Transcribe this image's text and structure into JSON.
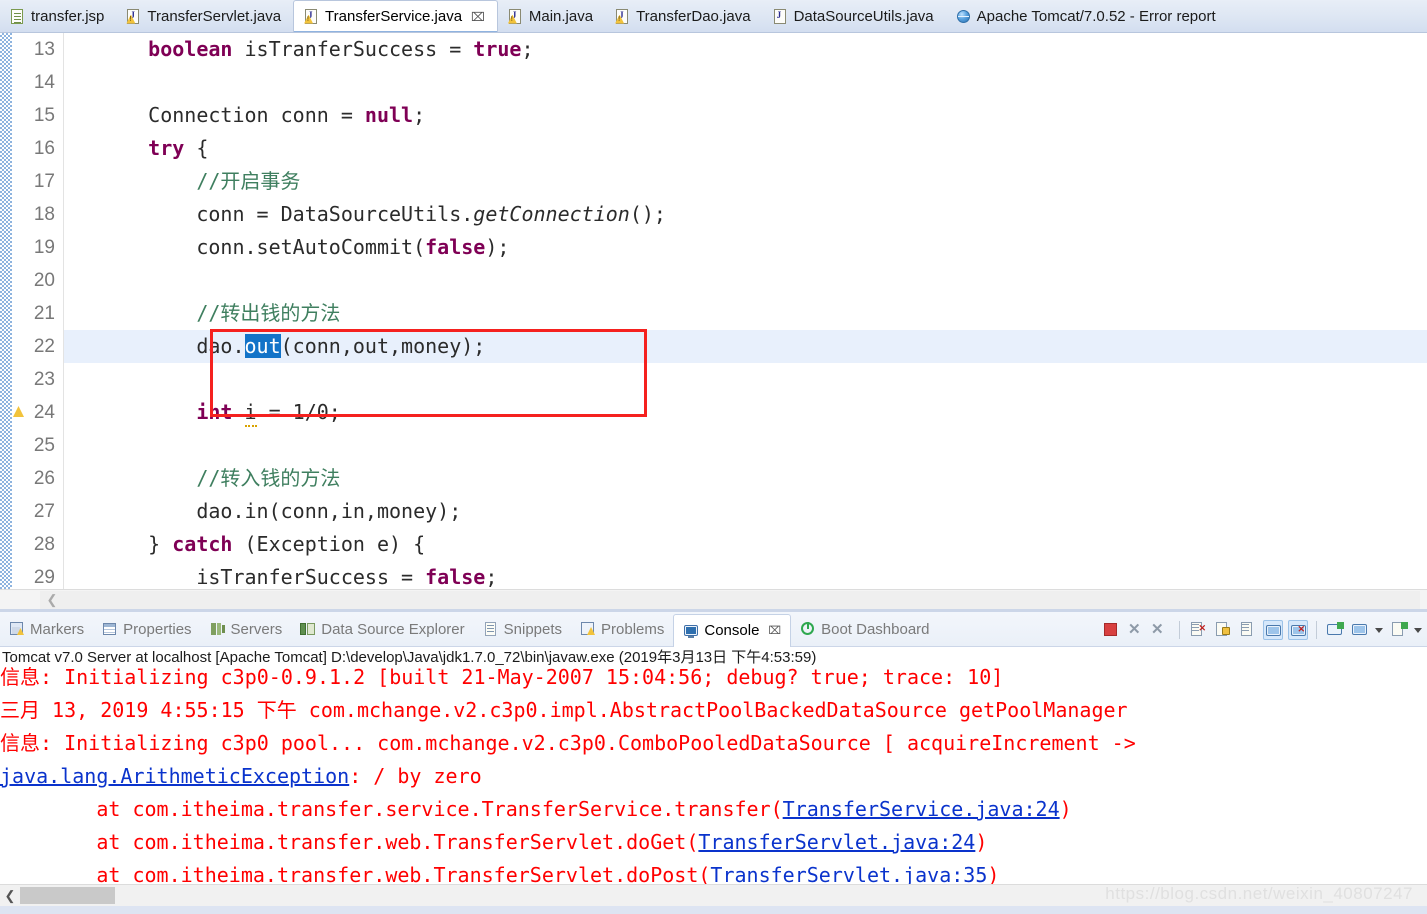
{
  "editor_tabs": [
    {
      "label": "transfer.jsp",
      "icon": "jsp-file-icon",
      "active": false,
      "closable": false
    },
    {
      "label": "TransferServlet.java",
      "icon": "java-file-warning-icon",
      "active": false,
      "closable": false
    },
    {
      "label": "TransferService.java",
      "icon": "java-file-warning-icon",
      "active": true,
      "closable": true
    },
    {
      "label": "Main.java",
      "icon": "java-file-warning-icon",
      "active": false,
      "closable": false
    },
    {
      "label": "TransferDao.java",
      "icon": "java-file-warning-icon",
      "active": false,
      "closable": false
    },
    {
      "label": "DataSourceUtils.java",
      "icon": "java-file-icon",
      "active": false,
      "closable": false
    },
    {
      "label": "Apache Tomcat/7.0.52 - Error report",
      "icon": "globe-icon",
      "active": false,
      "closable": false
    }
  ],
  "code": {
    "lines": [
      {
        "num": "13",
        "marker": null,
        "highlight": false,
        "tokens": [
          {
            "t": "    ",
            "c": "plain"
          },
          {
            "t": "boolean",
            "c": "kw"
          },
          {
            "t": " isTranferSuccess = ",
            "c": "plain"
          },
          {
            "t": "true",
            "c": "kw"
          },
          {
            "t": ";",
            "c": "plain"
          }
        ]
      },
      {
        "num": "14",
        "marker": null,
        "highlight": false,
        "tokens": []
      },
      {
        "num": "15",
        "marker": null,
        "highlight": false,
        "tokens": [
          {
            "t": "    Connection conn = ",
            "c": "plain"
          },
          {
            "t": "null",
            "c": "kw"
          },
          {
            "t": ";",
            "c": "plain"
          }
        ]
      },
      {
        "num": "16",
        "marker": null,
        "highlight": false,
        "tokens": [
          {
            "t": "    ",
            "c": "plain"
          },
          {
            "t": "try",
            "c": "kw"
          },
          {
            "t": " {",
            "c": "plain"
          }
        ]
      },
      {
        "num": "17",
        "marker": null,
        "highlight": false,
        "tokens": [
          {
            "t": "        //开启事务",
            "c": "cmt"
          }
        ]
      },
      {
        "num": "18",
        "marker": null,
        "highlight": false,
        "tokens": [
          {
            "t": "        conn = DataSourceUtils.",
            "c": "plain"
          },
          {
            "t": "getConnection",
            "c": "stat"
          },
          {
            "t": "();",
            "c": "plain"
          }
        ]
      },
      {
        "num": "19",
        "marker": null,
        "highlight": false,
        "tokens": [
          {
            "t": "        conn.setAutoCommit(",
            "c": "plain"
          },
          {
            "t": "false",
            "c": "kw"
          },
          {
            "t": ");",
            "c": "plain"
          }
        ]
      },
      {
        "num": "20",
        "marker": null,
        "highlight": false,
        "tokens": []
      },
      {
        "num": "21",
        "marker": null,
        "highlight": false,
        "tokens": [
          {
            "t": "        //转出钱的方法",
            "c": "cmt"
          }
        ]
      },
      {
        "num": "22",
        "marker": null,
        "highlight": true,
        "tokens": [
          {
            "t": "        dao.",
            "c": "plain"
          },
          {
            "t": "out",
            "c": "sel"
          },
          {
            "t": "(conn,out,money);",
            "c": "plain"
          }
        ]
      },
      {
        "num": "23",
        "marker": null,
        "highlight": false,
        "tokens": []
      },
      {
        "num": "24",
        "marker": "warning",
        "highlight": false,
        "tokens": [
          {
            "t": "        ",
            "c": "plain"
          },
          {
            "t": "int",
            "c": "kw"
          },
          {
            "t": " ",
            "c": "plain"
          },
          {
            "t": "i",
            "c": "squig"
          },
          {
            "t": " = 1/0;",
            "c": "plain"
          }
        ]
      },
      {
        "num": "25",
        "marker": null,
        "highlight": false,
        "tokens": []
      },
      {
        "num": "26",
        "marker": null,
        "highlight": false,
        "tokens": [
          {
            "t": "        //转入钱的方法",
            "c": "cmt"
          }
        ]
      },
      {
        "num": "27",
        "marker": null,
        "highlight": false,
        "tokens": [
          {
            "t": "        dao.in(conn,in,money);",
            "c": "plain"
          }
        ]
      },
      {
        "num": "28",
        "marker": null,
        "highlight": false,
        "tokens": [
          {
            "t": "    } ",
            "c": "plain"
          },
          {
            "t": "catch",
            "c": "kw"
          },
          {
            "t": " (Exception e) {",
            "c": "plain"
          }
        ]
      },
      {
        "num": "29",
        "marker": null,
        "highlight": false,
        "tokens": [
          {
            "t": "        isTranferSuccess = ",
            "c": "plain"
          },
          {
            "t": "false",
            "c": "kw"
          },
          {
            "t": ";",
            "c": "plain"
          }
        ]
      }
    ],
    "annotation_box_color": "#f5211f"
  },
  "view_tabs": [
    {
      "label": "Markers",
      "icon": "markers-icon",
      "active": false,
      "closable": false
    },
    {
      "label": "Properties",
      "icon": "properties-icon",
      "active": false,
      "closable": false
    },
    {
      "label": "Servers",
      "icon": "servers-icon",
      "active": false,
      "closable": false
    },
    {
      "label": "Data Source Explorer",
      "icon": "data-source-explorer-icon",
      "active": false,
      "closable": false
    },
    {
      "label": "Snippets",
      "icon": "snippets-icon",
      "active": false,
      "closable": false
    },
    {
      "label": "Problems",
      "icon": "problems-icon",
      "active": false,
      "closable": false
    },
    {
      "label": "Console",
      "icon": "console-icon",
      "active": true,
      "closable": true
    },
    {
      "label": "Boot Dashboard",
      "icon": "boot-dashboard-icon",
      "active": false,
      "closable": false
    }
  ],
  "console_toolbar": [
    {
      "name": "terminate-button",
      "icon": "stop-red-square-icon",
      "enabled": true,
      "toggled": false
    },
    {
      "name": "remove-launch-button",
      "icon": "x-gray-icon",
      "enabled": false,
      "toggled": false
    },
    {
      "name": "remove-all-terminated-button",
      "icon": "double-x-gray-icon",
      "enabled": false,
      "toggled": false
    },
    {
      "name": "clear-console-button",
      "icon": "clear-console-icon",
      "enabled": true,
      "toggled": false
    },
    {
      "name": "scroll-lock-button",
      "icon": "scroll-lock-icon",
      "enabled": true,
      "toggled": false
    },
    {
      "name": "word-wrap-button",
      "icon": "word-wrap-icon",
      "enabled": true,
      "toggled": false
    },
    {
      "name": "show-console-on-output-button",
      "icon": "console-output-icon",
      "enabled": true,
      "toggled": true
    },
    {
      "name": "show-console-on-error-button",
      "icon": "console-error-icon",
      "enabled": true,
      "toggled": true
    },
    {
      "name": "pin-console-button",
      "icon": "pin-console-icon",
      "enabled": true,
      "toggled": false
    },
    {
      "name": "display-selected-console-button",
      "icon": "display-console-icon",
      "enabled": true,
      "toggled": false
    },
    {
      "name": "display-selected-console-dropdown",
      "icon": "chevron-down-icon",
      "enabled": true,
      "toggled": false
    },
    {
      "name": "open-console-button",
      "icon": "new-console-icon",
      "enabled": true,
      "toggled": false
    },
    {
      "name": "open-console-dropdown",
      "icon": "chevron-down-icon",
      "enabled": true,
      "toggled": false
    }
  ],
  "console": {
    "status_line": "Tomcat v7.0 Server at localhost [Apache Tomcat] D:\\develop\\Java\\jdk1.7.0_72\\bin\\javaw.exe (2019年3月13日 下午4:53:59)",
    "output": [
      {
        "id": "c3p0-init",
        "segments": [
          {
            "t": "信息: Initializing c3p0-0.9.1.2 [built 21-May-2007 15:04:56; debug? true; trace: 10]",
            "c": "red"
          }
        ]
      },
      {
        "id": "pool-manager",
        "segments": [
          {
            "t": "三月 13, 2019 4:55:15 下午 com.mchange.v2.c3p0.impl.AbstractPoolBackedDataSource getPoolManager",
            "c": "red"
          }
        ]
      },
      {
        "id": "pool-init",
        "segments": [
          {
            "t": "信息: Initializing c3p0 pool... com.mchange.v2.c3p0.ComboPooledDataSource [ acquireIncrement ->",
            "c": "red"
          }
        ]
      },
      {
        "id": "exception-header",
        "segments": [
          {
            "t": "java.lang.ArithmeticException",
            "c": "link"
          },
          {
            "t": ": / by zero",
            "c": "red"
          }
        ]
      },
      {
        "id": "trace-1",
        "segments": [
          {
            "t": "\tat com.itheima.transfer.service.TransferService.transfer(",
            "c": "red"
          },
          {
            "t": "TransferService.java:24",
            "c": "link"
          },
          {
            "t": ")",
            "c": "red"
          }
        ]
      },
      {
        "id": "trace-2",
        "segments": [
          {
            "t": "\tat com.itheima.transfer.web.TransferServlet.doGet(",
            "c": "red"
          },
          {
            "t": "TransferServlet.java:24",
            "c": "link"
          },
          {
            "t": ")",
            "c": "red"
          }
        ]
      },
      {
        "id": "trace-3",
        "segments": [
          {
            "t": "\tat com.itheima.transfer.web.TransferServlet.doPost(",
            "c": "red"
          },
          {
            "t": "TransferServlet.java:35",
            "c": "blue"
          },
          {
            "t": ")",
            "c": "red"
          }
        ]
      }
    ]
  },
  "watermark": "https://blog.csdn.net/weixin_40807247",
  "colors": {
    "keyword": "#7f0055",
    "comment": "#3f7f5f",
    "selection": "#1273c8",
    "console_text": "#ff0000",
    "console_link": "#0a33cc",
    "annotation": "#f5211f",
    "line_highlight": "#e8f0fc"
  }
}
